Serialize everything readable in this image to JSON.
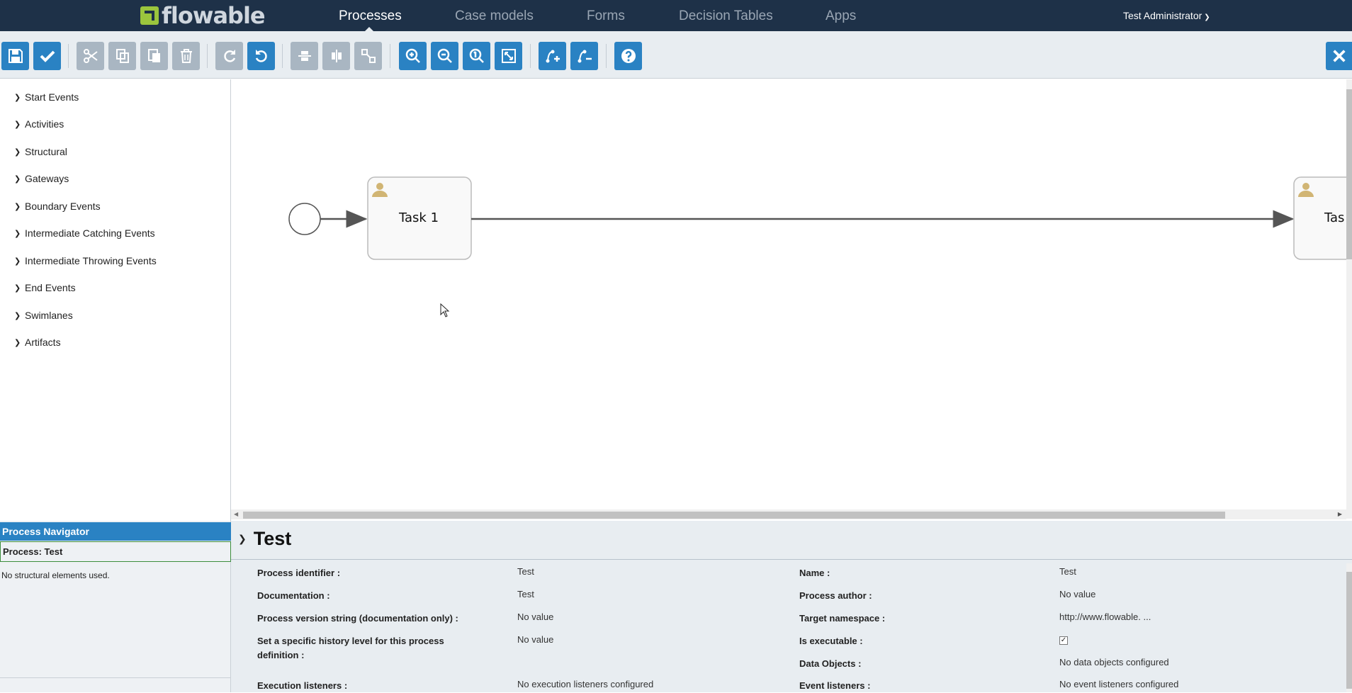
{
  "app": {
    "logo_text": "flowable",
    "nav": [
      "Processes",
      "Case models",
      "Forms",
      "Decision Tables",
      "Apps"
    ],
    "active_nav": "Processes",
    "user": "Test Administrator"
  },
  "toolbar": {
    "buttons": [
      {
        "icon": "save-icon",
        "state": "enabled"
      },
      {
        "icon": "check-icon",
        "state": "enabled"
      },
      {
        "icon": "cut-icon",
        "state": "disabled"
      },
      {
        "icon": "copy-icon",
        "state": "disabled"
      },
      {
        "icon": "paste-icon",
        "state": "disabled"
      },
      {
        "icon": "delete-icon",
        "state": "disabled"
      },
      {
        "icon": "redo-icon",
        "state": "disabled"
      },
      {
        "icon": "undo-icon",
        "state": "enabled"
      },
      {
        "icon": "align-horizontal-icon",
        "state": "disabled"
      },
      {
        "icon": "align-vertical-icon",
        "state": "disabled"
      },
      {
        "icon": "same-size-icon",
        "state": "disabled"
      },
      {
        "icon": "zoom-in-icon",
        "state": "enabled"
      },
      {
        "icon": "zoom-out-icon",
        "state": "enabled"
      },
      {
        "icon": "zoom-actual-icon",
        "state": "enabled"
      },
      {
        "icon": "zoom-fit-icon",
        "state": "enabled"
      },
      {
        "icon": "add-bendpoint-icon",
        "state": "enabled"
      },
      {
        "icon": "remove-bendpoint-icon",
        "state": "enabled"
      },
      {
        "icon": "help-icon",
        "state": "enabled"
      }
    ],
    "close_icon": "close-icon"
  },
  "palette": {
    "groups": [
      "Start Events",
      "Activities",
      "Structural",
      "Gateways",
      "Boundary Events",
      "Intermediate Catching Events",
      "Intermediate Throwing Events",
      "End Events",
      "Swimlanes",
      "Artifacts"
    ]
  },
  "diagram": {
    "tasks": [
      {
        "label": "Task 1",
        "icon": "user-icon"
      },
      {
        "label": "Tas",
        "icon": "user-icon"
      }
    ]
  },
  "navigator": {
    "header": "Process Navigator",
    "process": "Process: Test",
    "empty_text": "No structural elements used."
  },
  "properties": {
    "title": "Test",
    "left": [
      {
        "label": "Process identifier :",
        "value": "Test"
      },
      {
        "label": "Documentation :",
        "value": "Test"
      },
      {
        "label": "Process version string (documentation only) :",
        "value": "No value"
      },
      {
        "label": "Set a specific history level for this process definition :",
        "value": "No value"
      },
      {
        "label": "Execution listeners :",
        "value": "No execution listeners configured"
      }
    ],
    "right": [
      {
        "label": "Name :",
        "value": "Test"
      },
      {
        "label": "Process author :",
        "value": "No value"
      },
      {
        "label": "Target namespace :",
        "value": "http://www.flowable. ..."
      },
      {
        "label": "Is executable :",
        "value": "",
        "checked": true
      },
      {
        "label": "Data Objects :",
        "value": "No data objects configured"
      },
      {
        "label": "Event listeners :",
        "value": "No event listeners configured"
      }
    ]
  }
}
